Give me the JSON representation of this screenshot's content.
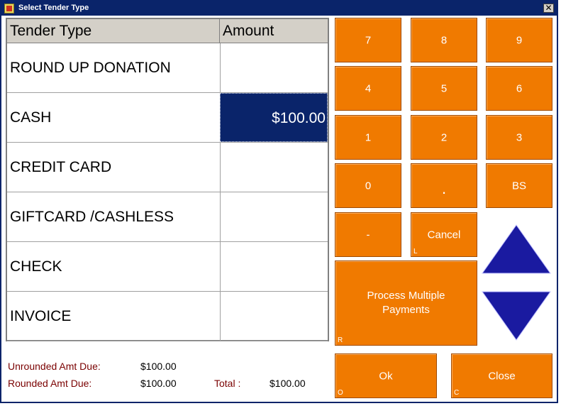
{
  "window": {
    "title": "Select Tender Type",
    "close_label": "✕"
  },
  "grid": {
    "headers": {
      "type": "Tender Type",
      "amount": "Amount"
    },
    "rows": [
      {
        "name": "ROUND UP DONATION",
        "amount": ""
      },
      {
        "name": "CASH",
        "amount": "$100.00"
      },
      {
        "name": "CREDIT CARD",
        "amount": ""
      },
      {
        "name": "GIFTCARD /CASHLESS",
        "amount": ""
      },
      {
        "name": "CHECK",
        "amount": ""
      },
      {
        "name": "INVOICE",
        "amount": ""
      }
    ]
  },
  "summary": {
    "unrounded_label": "Unrounded Amt Due:",
    "unrounded_value": "$100.00",
    "rounded_label": "Rounded Amt Due:",
    "rounded_value": "$100.00",
    "total_label": "Total :",
    "total_value": "$100.00"
  },
  "keypad": {
    "k7": "7",
    "k8": "8",
    "k9": "9",
    "k4": "4",
    "k5": "5",
    "k6": "6",
    "k1": "1",
    "k2": "2",
    "k3": "3",
    "k0": "0",
    "kdot": ".",
    "kbs": "BS",
    "kminus": "-",
    "cancel": "Cancel",
    "cancel_hotkey": "L",
    "process_multiple": "Process Multiple Payments",
    "process_hotkey": "R",
    "ok": "Ok",
    "ok_hotkey": "O",
    "close": "Close",
    "close_hotkey": "C"
  },
  "colors": {
    "button_orange": "#f07a00",
    "title_blue": "#0a246a",
    "arrow_blue": "#1a1aa0",
    "label_red": "#7a0000"
  }
}
